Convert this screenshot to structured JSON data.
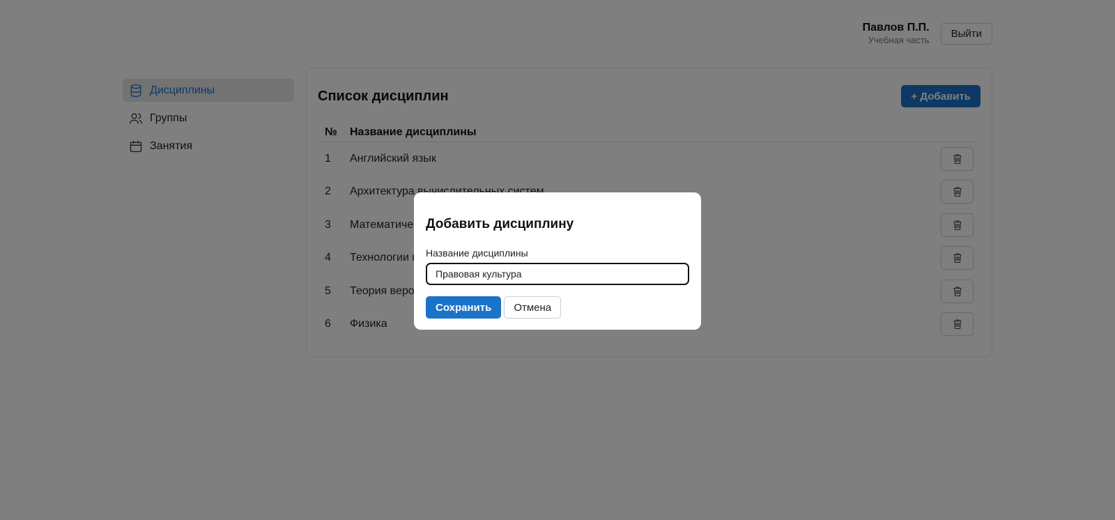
{
  "header": {
    "user_name": "Павлов П.П.",
    "user_role": "Учебная часть",
    "logout_label": "Выйти"
  },
  "sidebar": {
    "items": [
      {
        "label": "Дисциплины",
        "icon": "database-icon",
        "active": true
      },
      {
        "label": "Группы",
        "icon": "users-icon",
        "active": false
      },
      {
        "label": "Занятия",
        "icon": "calendar-icon",
        "active": false
      }
    ]
  },
  "main": {
    "title": "Список дисциплин",
    "add_label": "+ Добавить",
    "columns": {
      "num": "№",
      "name": "Название дисциплины"
    },
    "rows": [
      {
        "num": "1",
        "name": "Английский язык"
      },
      {
        "num": "2",
        "name": "Архитектура вычислительных систем"
      },
      {
        "num": "3",
        "name": "Математический анализ"
      },
      {
        "num": "4",
        "name": "Технологии программирования"
      },
      {
        "num": "5",
        "name": "Теория вероятностей"
      },
      {
        "num": "6",
        "name": "Физика"
      }
    ],
    "delete_icon": "trash-icon"
  },
  "modal": {
    "title": "Добавить дисциплину",
    "field_label": "Название дисциплины",
    "field_value": "Правовая культура",
    "save_label": "Сохранить",
    "cancel_label": "Отмена"
  },
  "colors": {
    "accent": "#1a73c8",
    "overlay": "rgba(0,0,0,0.5)"
  }
}
